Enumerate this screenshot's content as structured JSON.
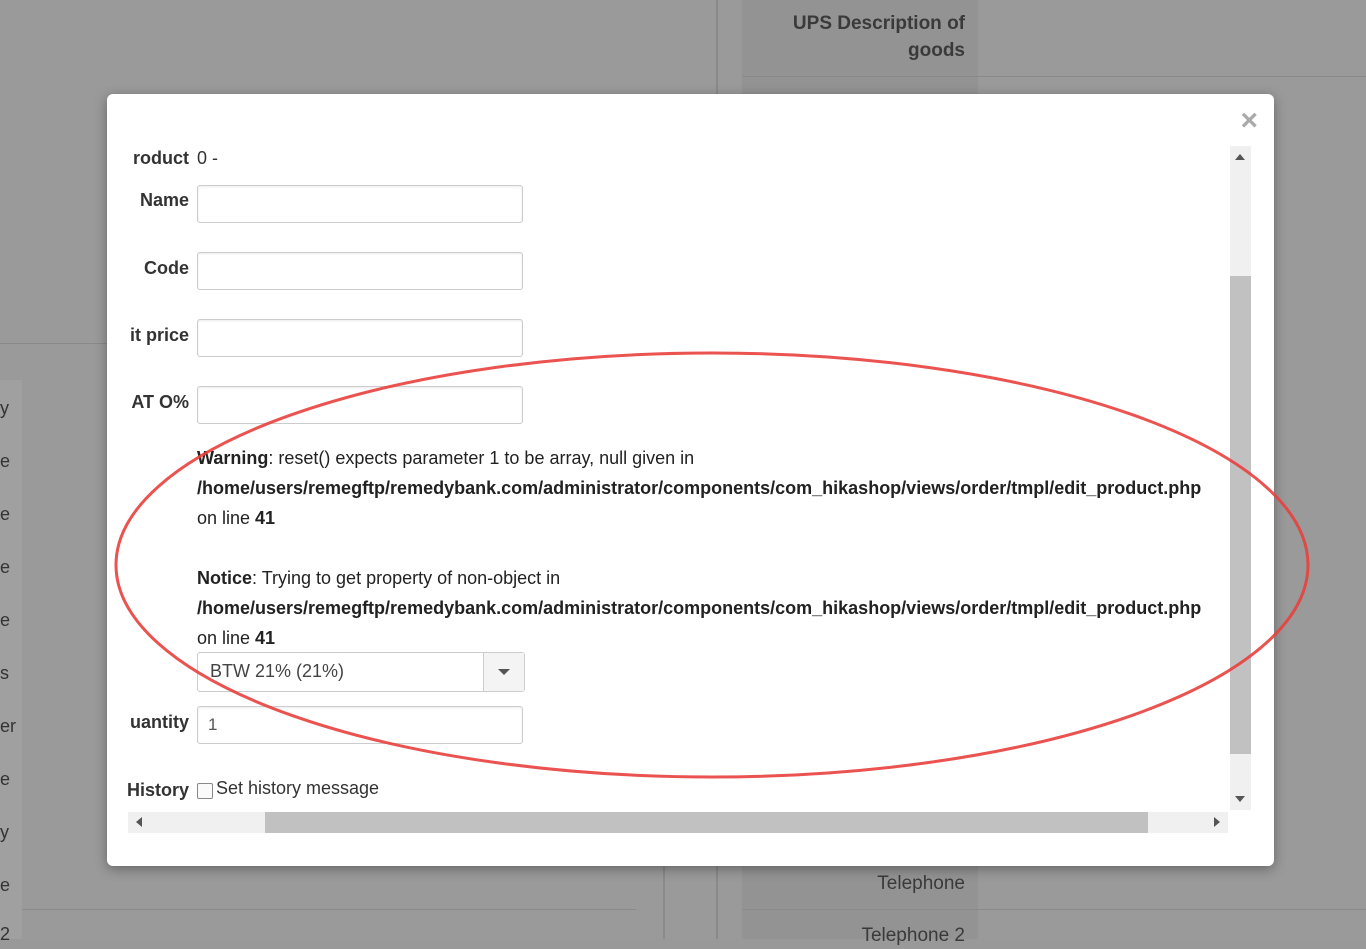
{
  "background": {
    "right_labels": [
      "UPS Description of",
      "goods",
      "Telephone",
      "Telephone 2"
    ],
    "left_fragments": [
      "y",
      "e",
      "e",
      "e",
      "e",
      "s",
      "er",
      "e",
      "y",
      "e",
      "2"
    ]
  },
  "modal": {
    "close_glyph": "×",
    "product": {
      "label": "roduct",
      "value": "0 -"
    },
    "name": {
      "label": "Name",
      "value": ""
    },
    "code": {
      "label": "Code",
      "value": ""
    },
    "unit_price": {
      "label": "it price",
      "value": ""
    },
    "vat": {
      "label": "AT O%",
      "value": ""
    },
    "warning": {
      "kind": "Warning",
      "text": ": reset() expects parameter 1 to be array, null given in",
      "path": "/home/users/remegftp/remedybank.com/administrator/components/com_hikashop/views/order/tmpl/edit_product.php",
      "line_prefix": "on line ",
      "line": "41"
    },
    "notice": {
      "kind": "Notice",
      "text": ": Trying to get property of non-object in",
      "path": "/home/users/remegftp/remedybank.com/administrator/components/com_hikashop/views/order/tmpl/edit_product.php",
      "line_prefix": "on line ",
      "line": "41"
    },
    "tax_select": {
      "selected": "BTW 21% (21%)"
    },
    "quantity": {
      "label": "uantity",
      "value": "1"
    },
    "history": {
      "label": "History",
      "checkbox_label": "Set history message",
      "checked": false
    }
  },
  "colors": {
    "annotation": "#e8403c",
    "overlay": "#999999"
  }
}
